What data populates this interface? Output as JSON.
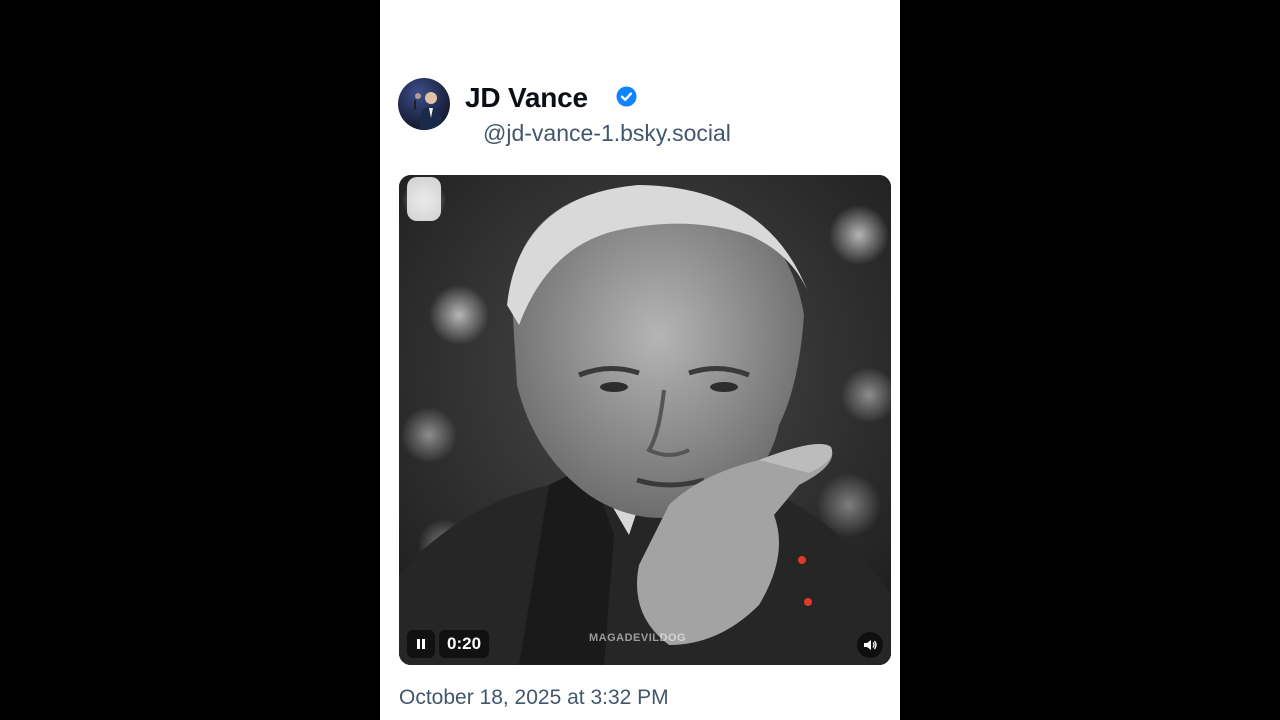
{
  "post": {
    "author": {
      "display_name": "JD Vance",
      "handle": "@jd-vance-1.bsky.social",
      "verified": true,
      "verified_icon": "verified-check-icon"
    },
    "video": {
      "elapsed": "0:20",
      "state": "playing",
      "watermark": "MAGADEVILDOG",
      "controls": {
        "pause_icon": "pause-icon",
        "volume_icon": "volume-icon"
      }
    },
    "timestamp": "October 18, 2025 at 3:32 PM"
  },
  "colors": {
    "page_background": "#000000",
    "card_background": "#ffffff",
    "name_text": "#0b0f14",
    "secondary_text": "#42576c",
    "verified_blue": "#1083fe"
  }
}
